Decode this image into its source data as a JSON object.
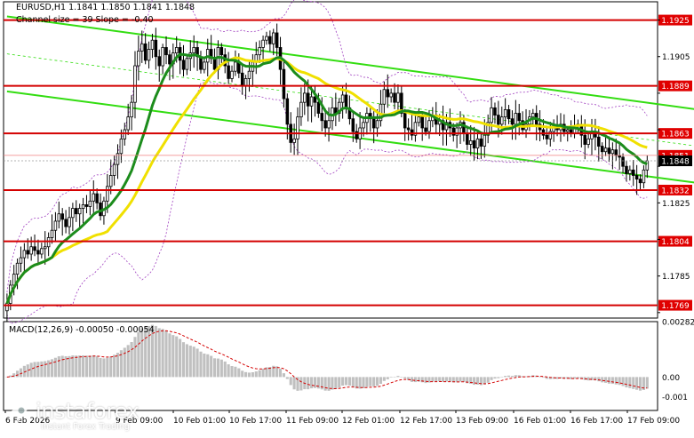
{
  "header": {
    "ohlc": "EURUSD,H1  1.1841 1.1850 1.1841 1.1848",
    "channel": "Channel size = 39 Slope = -0.40"
  },
  "macd": {
    "label": "MACD(12,26,9) -0.00050 -0.00054"
  },
  "watermark": {
    "brand": "instaforex",
    "tagline": "Instant Forex Trading"
  },
  "colors": {
    "candle": "#000000",
    "level_line": "#d40000",
    "level_tag": "#e00000",
    "channel": "#33dd11",
    "ma_fast": "#1c8c1c",
    "ma_slow": "#f0e000",
    "envelope": "#a040c0",
    "price_tag": "#000000",
    "macd_hist": "#c0c0c0",
    "macd_signal": "#d40000"
  },
  "chart_data": {
    "type": "candlestick",
    "symbol": "EURUSD",
    "timeframe": "H1",
    "ylim": [
      1.1762,
      1.1935
    ],
    "y_ticks": [
      "1.1925",
      "1.1905",
      "1.1885",
      "1.1865",
      "1.1845",
      "1.1825",
      "1.1805",
      "1.1785",
      "1.1765"
    ],
    "x_ticks": [
      "6 Feb 2026",
      "9 Feb 09:00",
      "10 Feb 01:00",
      "10 Feb 17:00",
      "11 Feb 09:00",
      "12 Feb 01:00",
      "12 Feb 17:00",
      "13 Feb 09:00",
      "16 Feb 01:00",
      "16 Feb 17:00",
      "17 Feb 09:00"
    ],
    "levels": [
      {
        "price": 1.1925,
        "label": "1.1925"
      },
      {
        "price": 1.1889,
        "label": "1.1889"
      },
      {
        "price": 1.1863,
        "label": "1.1863"
      },
      {
        "price": 1.1832,
        "label": "1.1832"
      },
      {
        "price": 1.1804,
        "label": "1.1804"
      },
      {
        "price": 1.1769,
        "label": "1.1769"
      }
    ],
    "current_price": {
      "price": 1.1848,
      "label": "1.1848"
    },
    "partial_tag": {
      "price": 1.1851,
      "label": "1.1851"
    },
    "channel": {
      "upper": [
        [
          0,
          1.1927
        ],
        [
          243,
          1.1865
        ]
      ],
      "lower": [
        [
          0,
          1.1886
        ],
        [
          243,
          1.1825
        ]
      ]
    },
    "close": [
      1.177,
      1.178,
      1.1786,
      1.1792,
      1.1795,
      1.1799,
      1.1797,
      1.1801,
      1.1799,
      1.1797,
      1.18,
      1.1801,
      1.1806,
      1.181,
      1.1815,
      1.1819,
      1.1816,
      1.1812,
      1.1817,
      1.1822,
      1.1819,
      1.1822,
      1.1824,
      1.1823,
      1.1826,
      1.183,
      1.1825,
      1.1818,
      1.1826,
      1.1834,
      1.184,
      1.1846,
      1.1852,
      1.186,
      1.1865,
      1.1872,
      1.188,
      1.19,
      1.1908,
      1.1912,
      1.1903,
      1.1909,
      1.1914,
      1.1905,
      1.19,
      1.191,
      1.1906,
      1.1901,
      1.1907,
      1.191,
      1.1903,
      1.1898,
      1.1904,
      1.1907,
      1.191,
      1.1905,
      1.1898,
      1.1902,
      1.1909,
      1.1904,
      1.1898,
      1.191,
      1.1906,
      1.19,
      1.1893,
      1.1897,
      1.1902,
      1.1896,
      1.1889,
      1.1893,
      1.1897,
      1.1902,
      1.1906,
      1.191,
      1.1914,
      1.1916,
      1.1912,
      1.1918,
      1.191,
      1.1898,
      1.1882,
      1.1868,
      1.1858,
      1.186,
      1.1872,
      1.188,
      1.1885,
      1.1878,
      1.1883,
      1.188,
      1.1874,
      1.187,
      1.1866,
      1.187,
      1.1877,
      1.1874,
      1.188,
      1.1884,
      1.1877,
      1.1871,
      1.1864,
      1.186,
      1.1866,
      1.1869,
      1.1874,
      1.1871,
      1.1866,
      1.187,
      1.1879,
      1.1887,
      1.1883,
      1.1885,
      1.188,
      1.1885,
      1.1874,
      1.1866,
      1.1865,
      1.1862,
      1.1869,
      1.1872,
      1.1866,
      1.1864,
      1.187,
      1.1873,
      1.1868,
      1.187,
      1.1865,
      1.1869,
      1.1866,
      1.1862,
      1.1866,
      1.1869,
      1.1863,
      1.1857,
      1.1859,
      1.1855,
      1.186,
      1.1856,
      1.1862,
      1.1869,
      1.1877,
      1.1873,
      1.1868,
      1.1872,
      1.1876,
      1.1871,
      1.1868,
      1.1874,
      1.187,
      1.1865,
      1.1868,
      1.1872,
      1.1874,
      1.1868,
      1.1865,
      1.1862,
      1.186,
      1.1864,
      1.1867,
      1.1865,
      1.1868,
      1.1864,
      1.1865,
      1.1863,
      1.1867,
      1.1868,
      1.1862,
      1.1857,
      1.186,
      1.1863,
      1.1861,
      1.1856,
      1.1853,
      1.1855,
      1.1852,
      1.1854,
      1.1851,
      1.185,
      1.1845,
      1.1841,
      1.1843,
      1.184,
      1.1838,
      1.1836,
      1.1843,
      1.1848
    ]
  }
}
